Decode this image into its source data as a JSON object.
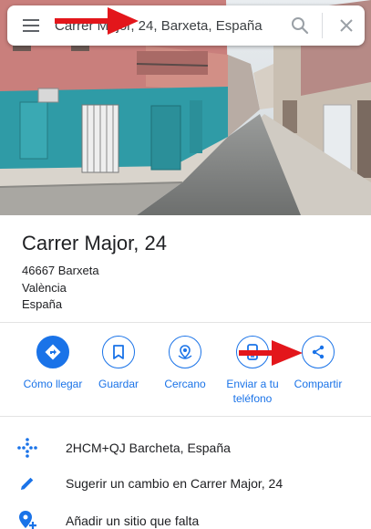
{
  "search": {
    "value": "Carrer Major, 24, Barxeta, España",
    "menu_icon": "hamburger-menu-icon",
    "search_icon": "search-icon",
    "close_icon": "close-icon"
  },
  "place": {
    "title": "Carrer Major, 24",
    "address_lines": [
      "46667 Barxeta",
      "València",
      "España"
    ]
  },
  "actions": [
    {
      "label": "Cómo llegar",
      "icon": "directions-icon"
    },
    {
      "label": "Guardar",
      "icon": "bookmark-icon"
    },
    {
      "label": "Cercano",
      "icon": "nearby-icon"
    },
    {
      "label": "Enviar a tu teléfono",
      "icon": "phone-icon"
    },
    {
      "label": "Compartir",
      "icon": "share-icon"
    }
  ],
  "details": [
    {
      "text": "2HCM+QJ Barcheta, España",
      "icon": "plus-code-icon"
    },
    {
      "text": "Sugerir un cambio en Carrer Major, 24",
      "icon": "edit-pencil-icon"
    },
    {
      "text": "Añadir un sitio que falta",
      "icon": "add-place-icon"
    }
  ],
  "colors": {
    "accent": "#1a73e8",
    "annotation_arrow": "#e3161b"
  }
}
